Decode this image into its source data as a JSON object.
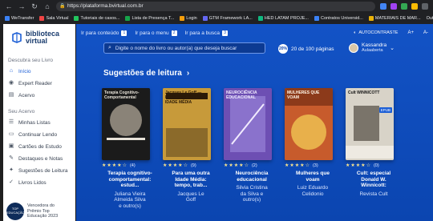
{
  "browser": {
    "url": "https://plataforma.bvirtual.com.br",
    "bookmarks": [
      {
        "label": "WeTransfer",
        "color": "#3b82f6"
      },
      {
        "label": "Sala Virtual",
        "color": "#ef4444"
      },
      {
        "label": "Tutoriais de casos...",
        "color": "#22c55e"
      },
      {
        "label": "Lista de Presença T...",
        "color": "#16a34a"
      },
      {
        "label": "Login",
        "color": "#f59e0b"
      },
      {
        "label": "GTM Framework LA...",
        "color": "#6366f1"
      },
      {
        "label": "HED LATAM PROJE...",
        "color": "#10b981"
      },
      {
        "label": "Contratos Universid...",
        "color": "#3b82f6"
      },
      {
        "label": "MATERIAIS DE MAR...",
        "color": "#eab308"
      }
    ],
    "other_bookmarks": "Outros favoritos"
  },
  "sidebar": {
    "logo_line1": "biblioteca",
    "logo_line2": "virtual",
    "section1": "Descubra seu Livro",
    "items1": [
      {
        "label": "Início",
        "icon": "home-icon",
        "active": true
      },
      {
        "label": "Expert Reader",
        "icon": "reader-icon",
        "active": false
      },
      {
        "label": "Acervo",
        "icon": "library-icon",
        "active": false
      }
    ],
    "section2": "Seu Acervo",
    "items2": [
      {
        "label": "Minhas Listas",
        "icon": "list-icon"
      },
      {
        "label": "Continuar Lendo",
        "icon": "book-open-icon"
      },
      {
        "label": "Cartões de Estudo",
        "icon": "cards-icon"
      },
      {
        "label": "Destaques e Notas",
        "icon": "highlight-icon"
      },
      {
        "label": "Sugestões de Leitura",
        "icon": "suggestion-icon"
      },
      {
        "label": "Livros Lidos",
        "icon": "check-book-icon"
      }
    ],
    "prize_line1": "Vencedora do",
    "prize_line2": "Prêmio Top",
    "prize_line3": "Educação 2023",
    "prize_badge": "TOP EDUCAÇÃO"
  },
  "topnav": {
    "skip1": "Ir para conteúdo",
    "key1": "1",
    "skip2": "Ir para o menu",
    "key2": "2",
    "skip3": "Ir para a busca",
    "key3": "3",
    "contrast": "AUTOCONTRASTE",
    "font_up": "A+",
    "font_down": "A-"
  },
  "search": {
    "placeholder": "Digite o nome do livro ou autor(a) que deseja buscar"
  },
  "pages": {
    "badge": "20%",
    "text": "20 de 100 páginas"
  },
  "user": {
    "name": "Kassandra",
    "org": "Aulaaberta"
  },
  "section_title": "Sugestões de leitura",
  "books": [
    {
      "title_l1": "Terapia cognitivo-",
      "title_l2": "comportamental:",
      "title_l3": "estud...",
      "author_l1": "Juliana Vieira",
      "author_l2": "Almeida Silva",
      "author_l3": "e outro(s)",
      "stars": 4,
      "count": "(4)",
      "cover_bg": "#1b1b1b",
      "cover_fg": "#e7e2d8",
      "cover_text": "Terapia Cognitivo-Comportamental"
    },
    {
      "title_l1": "Para uma outra",
      "title_l2": "Idade Média:",
      "title_l3": "tempo, trab...",
      "author_l1": "Jacques Le",
      "author_l2": "Goff",
      "author_l3": "",
      "stars": 4,
      "count": "(9)",
      "cover_bg": "#c79a3a",
      "cover_fg": "#2b1a08",
      "cover_text": "Jacques Le Goff — PARA UMA OUTRA IDADE MÉDIA"
    },
    {
      "title_l1": "Neurociência",
      "title_l2": "educacional",
      "title_l3": "",
      "author_l1": "Silvia Cristina",
      "author_l2": "da Silva e",
      "author_l3": "outro(s)",
      "stars": 4,
      "count": "(2)",
      "cover_bg": "#6d4fb3",
      "cover_fg": "#f2ecff",
      "cover_text": "NEUROCIÊNCIA EDUCACIONAL"
    },
    {
      "title_l1": "Mulheres que",
      "title_l2": "voam",
      "title_l3": "",
      "author_l1": "Luiz Eduardo",
      "author_l2": "Celidonio",
      "author_l3": "",
      "stars": 4,
      "count": "(3)",
      "cover_bg": "#c75b2c",
      "cover_fg": "#fff6e8",
      "cover_text": "MULHERES QUE VOAM"
    },
    {
      "title_l1": "Cult: especial",
      "title_l2": "Donald W.",
      "title_l3": "Winnicott:",
      "author_l1": "Revista Cult",
      "author_l2": "",
      "author_l3": "",
      "stars": 4,
      "count": "(0)",
      "cover_bg": "#d8d3c8",
      "cover_fg": "#141414",
      "cover_text": "Cult WINNICOTT",
      "badge": "EPUB"
    }
  ]
}
